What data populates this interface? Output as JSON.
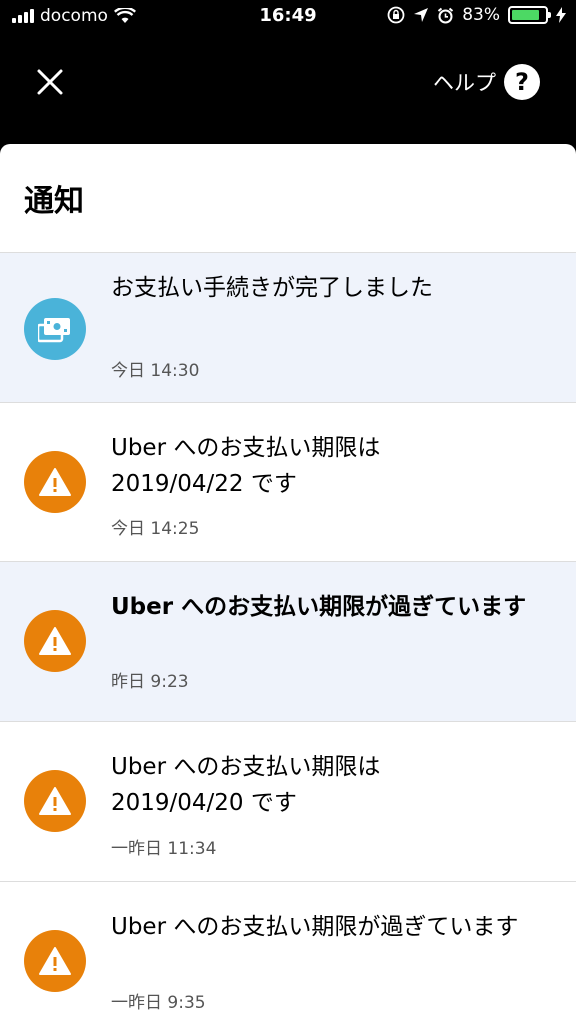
{
  "status_bar": {
    "carrier": "docomo",
    "time": "16:49",
    "battery_percent": "83%",
    "battery_level": 0.83
  },
  "header": {
    "close_icon": "close-icon",
    "help_label": "ヘルプ",
    "help_icon_glyph": "?"
  },
  "page": {
    "title": "通知"
  },
  "notifications": [
    {
      "icon": "payment-icon",
      "icon_color": "#4ab3d9",
      "title": "お支払い手続きが完了しました",
      "time": "今日 14:30",
      "unread": true
    },
    {
      "icon": "warning-icon",
      "icon_color": "#e8810a",
      "title_line1": "Uber へのお支払い期限は",
      "title_line2": "2019/04/22 です",
      "time": "今日 14:25",
      "unread": false
    },
    {
      "icon": "warning-icon",
      "icon_color": "#e8810a",
      "title": "Uber へのお支払い期限が過ぎています",
      "time": "昨日 9:23",
      "unread": true
    },
    {
      "icon": "warning-icon",
      "icon_color": "#e8810a",
      "title_line1": "Uber へのお支払い期限は",
      "title_line2": "2019/04/20 です",
      "time": "一昨日 11:34",
      "unread": false
    },
    {
      "icon": "warning-icon",
      "icon_color": "#e8810a",
      "title": "Uber へのお支払い期限が過ぎています",
      "time": "一昨日 9:35",
      "unread": false
    }
  ]
}
